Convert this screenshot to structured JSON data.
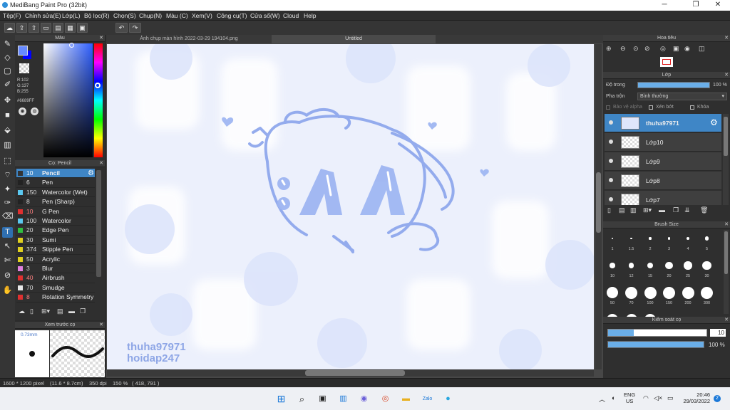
{
  "window": {
    "title": "MediBang Paint Pro (32bit)"
  },
  "menu": [
    "Tệp(F)",
    "Chỉnh sửa(E)",
    "Lớp(L)",
    "Bộ lọc(R)",
    "Chọn(S)",
    "Chụp(N)",
    "Màu (C)",
    "Xem(V)",
    "Công cụ(T)",
    "Cửa sổ(W)",
    "Cloud",
    "Help"
  ],
  "panels": {
    "color": "Màu",
    "brush": "Cọ: Pencil",
    "preview": "Xem trước cọ",
    "navigator": "Hoa tiêu",
    "layer": "Lớp",
    "brush_size": "Brush Size",
    "brush_control": "Kiểm soát cọ"
  },
  "color": {
    "r": "R:102",
    "g": "G:137",
    "b": "B:255",
    "hex": "#6689FF",
    "primary": "#6689ff",
    "secondary": "#0000ff"
  },
  "brushes": [
    {
      "size": "10",
      "name": "Pencil",
      "color": "#333333"
    },
    {
      "size": "6",
      "name": "Pen",
      "color": "#222222"
    },
    {
      "size": "150",
      "name": "Watercolor (Wet)",
      "color": "#5bc8f0"
    },
    {
      "size": "8",
      "name": "Pen (Sharp)",
      "color": "#222222"
    },
    {
      "size": "10",
      "name": "G Pen",
      "color": "#e03030"
    },
    {
      "size": "100",
      "name": "Watercolor",
      "color": "#5bc8f0"
    },
    {
      "size": "20",
      "name": "Edge Pen",
      "color": "#30c040"
    },
    {
      "size": "30",
      "name": "Sumi",
      "color": "#e0d020"
    },
    {
      "size": "374",
      "name": "Stipple Pen",
      "color": "#e0d020"
    },
    {
      "size": "50",
      "name": "Acrylic",
      "color": "#e0d020"
    },
    {
      "size": "3",
      "name": "Blur",
      "color": "#e080e0"
    },
    {
      "size": "40",
      "name": "Airbrush",
      "color": "#e03030"
    },
    {
      "size": "70",
      "name": "Smudge",
      "color": "#e8e8e8"
    },
    {
      "size": "8",
      "name": "Rotation Symmetry",
      "color": "#e03030"
    }
  ],
  "brush_preview": {
    "size_label": "0.73mm"
  },
  "tabs": {
    "file1": "Ảnh chụp màn hình 2022-03-29 194104.png",
    "file2": "Untitled"
  },
  "canvas_text": {
    "line1": "thuha97971",
    "line2": "hoidap247"
  },
  "layer": {
    "opacity_label": "Độ trong",
    "opacity_value": "100 %",
    "opacity_fraction": 1.0,
    "blend_label": "Pha trộn",
    "blend_value": "Bình thường",
    "protect_alpha": "Bảo vệ alpha",
    "clip": "Xén bớt",
    "lock": "Khóa",
    "items": [
      "thuha97971",
      "Lớp10",
      "Lớp9",
      "Lớp8",
      "Lớp7"
    ]
  },
  "brush_sizes": [
    "1",
    "1.5",
    "2",
    "3",
    "4",
    "5",
    "10",
    "12",
    "15",
    "20",
    "25",
    "30",
    "50",
    "70",
    "100",
    "150",
    "200",
    "300"
  ],
  "brush_control": {
    "size_value": "10",
    "size_fraction": 0.1,
    "opacity_value": "100 %",
    "opacity_fraction": 1.0
  },
  "status": {
    "dims": "1600 * 1200 pixel",
    "physical": "(11.6 * 8.7cm)",
    "dpi": "350 dpi",
    "zoom": "150 %",
    "coords": "( 418, 791 )"
  },
  "taskbar": {
    "lang1": "ENG",
    "lang2": "US",
    "time": "20:46",
    "date": "29/03/2022",
    "notif": "2"
  }
}
